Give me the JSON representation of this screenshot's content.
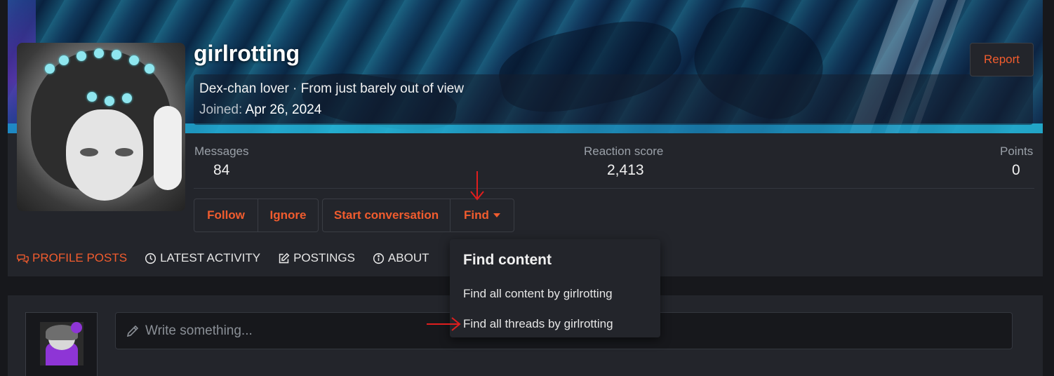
{
  "profile": {
    "username": "girlrotting",
    "tagline": "Dex-chan lover · From just barely out of view",
    "joined_label": "Joined:",
    "joined_date": "Apr 26, 2024",
    "report_label": "Report"
  },
  "stats": {
    "messages_label": "Messages",
    "messages_value": "84",
    "reaction_label": "Reaction score",
    "reaction_value": "2,413",
    "points_label": "Points",
    "points_value": "0"
  },
  "actions": {
    "follow": "Follow",
    "ignore": "Ignore",
    "start_conversation": "Start conversation",
    "find": "Find"
  },
  "tabs": [
    {
      "label": "PROFILE POSTS",
      "icon": "comments-icon",
      "active": true
    },
    {
      "label": "LATEST ACTIVITY",
      "icon": "clock-icon",
      "active": false
    },
    {
      "label": "POSTINGS",
      "icon": "edit-icon",
      "active": false
    },
    {
      "label": "ABOUT",
      "icon": "info-icon",
      "active": false
    }
  ],
  "composer": {
    "placeholder": "Write something..."
  },
  "find_menu": {
    "title": "Find content",
    "items": [
      "Find all content by girlrotting",
      "Find all threads by girlrotting"
    ]
  },
  "colors": {
    "accent": "#f15c2e",
    "panel": "#23252b",
    "page_bg": "#17181c",
    "annotation": "#e01e1e"
  }
}
